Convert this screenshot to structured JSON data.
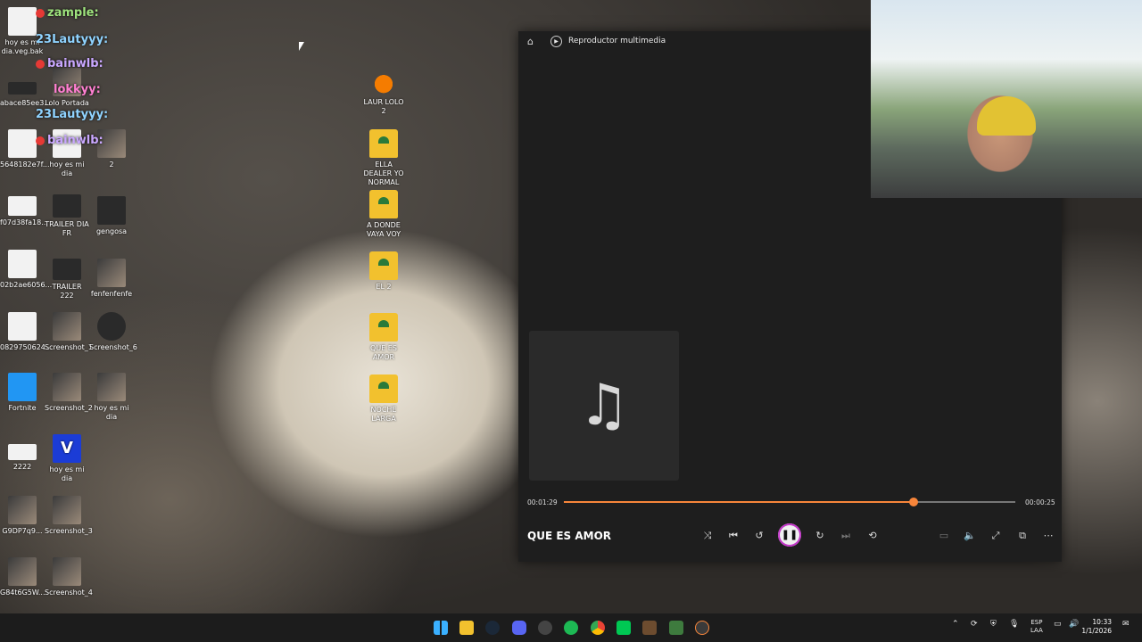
{
  "desktop": {
    "icons_col1": [
      "hoy es mi dia.veg.bak",
      "abace85ee3...",
      "5648182e7f...",
      "f07d38fa18...",
      "02b2ae6056...",
      "0829750624...",
      "Fortnite",
      "2222",
      "G9DP7q9...",
      "G84t6G5W..."
    ],
    "icons_col2": [
      "Lolo Portada",
      "hoy es mi dia",
      "TRAILER DIA FR",
      "TRAILER 222",
      "Screenshot_1",
      "Screenshot_2",
      "hoy es mi dia",
      "Screenshot_3",
      "Screenshot_4"
    ],
    "icons_col3": [
      "2",
      "gengosa",
      "fenfenfenfe",
      "Screenshot_6",
      "hoy es mi dia"
    ],
    "icons_col4": [
      "LAUR LOLO 2",
      "ELLA DEALER YO NORMAL",
      "A DONDE VAYA VOY",
      "EL 2",
      "QUE ES AMOR",
      "NOCHE LARGA"
    ],
    "chat": [
      "zample:",
      "23Lautyyy:",
      "bainwlb:",
      "lokkyy:",
      "23Lautyyy:",
      "bainwlb:"
    ]
  },
  "player": {
    "app_title": "Reproductor multimedia",
    "song_title": "QUE ES AMOR",
    "elapsed": "00:01:29",
    "remaining": "00:00:25",
    "progress_fraction": 0.775,
    "accent": "#f7853a",
    "controls": [
      "shuffle-icon",
      "previous-icon",
      "rewind-10-icon",
      "pause-icon",
      "forward-30-icon",
      "next-icon",
      "repeat-off-icon",
      "miniplayer-icon",
      "volume-icon",
      "fullscreen-icon",
      "cast-icon",
      "more-icon"
    ]
  },
  "taskbar": {
    "language_top": "ESP",
    "language_bottom": "LAA",
    "time": "10:33",
    "date": "1/1/2026"
  }
}
